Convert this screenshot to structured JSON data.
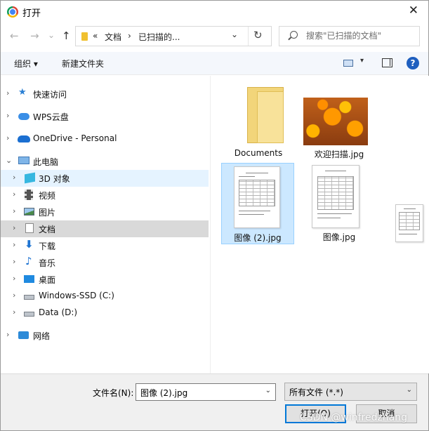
{
  "window": {
    "title": "打开",
    "close_glyph": "✕"
  },
  "nav_buttons": {
    "back": "←",
    "forward": "→",
    "recent": "⌄",
    "up": "↑"
  },
  "address": {
    "overflow": "«",
    "crumb_1": "文档",
    "separator": "›",
    "crumb_2": "已扫描的...",
    "dropdown": "⌄",
    "refresh": "↻"
  },
  "search": {
    "placeholder": "搜索\"已扫描的文档\""
  },
  "toolbar": {
    "organize": "组织 ▾",
    "new_folder": "新建文件夹",
    "view_dropdown": "▾",
    "help": "?"
  },
  "sidebar": {
    "items": [
      {
        "label": "快速访问",
        "icon": "star-icon",
        "chevron": "›"
      },
      {
        "label": "WPS云盘",
        "icon": "cloud-icon",
        "chevron": "›"
      },
      {
        "label": "OneDrive - Personal",
        "icon": "onedrive-icon",
        "chevron": "›"
      },
      {
        "label": "此电脑",
        "icon": "pc-icon",
        "chevron": "⌄"
      },
      {
        "label": "3D 对象",
        "icon": "cube-icon",
        "chevron": "›"
      },
      {
        "label": "视频",
        "icon": "video-icon",
        "chevron": "›"
      },
      {
        "label": "图片",
        "icon": "picture-icon",
        "chevron": "›"
      },
      {
        "label": "文档",
        "icon": "document-icon",
        "chevron": "›"
      },
      {
        "label": "下载",
        "icon": "download-icon",
        "chevron": "›"
      },
      {
        "label": "音乐",
        "icon": "music-icon",
        "chevron": "›"
      },
      {
        "label": "桌面",
        "icon": "desktop-icon",
        "chevron": "›"
      },
      {
        "label": "Windows-SSD (C:)",
        "icon": "drive-icon",
        "chevron": "›"
      },
      {
        "label": "Data (D:)",
        "icon": "drive-icon",
        "chevron": "›"
      },
      {
        "label": "网络",
        "icon": "network-icon",
        "chevron": "›"
      }
    ]
  },
  "files": [
    {
      "name": "Documents",
      "kind": "folder"
    },
    {
      "name": "欢迎扫描.jpg",
      "kind": "photo"
    },
    {
      "name": "图像 (2).jpg",
      "kind": "scan",
      "selected": true
    },
    {
      "name": "图像.jpg",
      "kind": "scan"
    }
  ],
  "footer": {
    "filename_label": "文件名(N):",
    "filename_value": "图像 (2).jpg",
    "filetype_value": "所有文件 (*.*)",
    "combo_arrow": "⌄",
    "open_label": "打开(O)",
    "cancel_label": "取消"
  },
  "watermark": "CSDN @winfredzhang",
  "colors": {
    "accent": "#0078d7",
    "selection": "#cce8ff",
    "nav_hover": "#e5f3ff",
    "nav_selected": "#d9d9d9"
  }
}
